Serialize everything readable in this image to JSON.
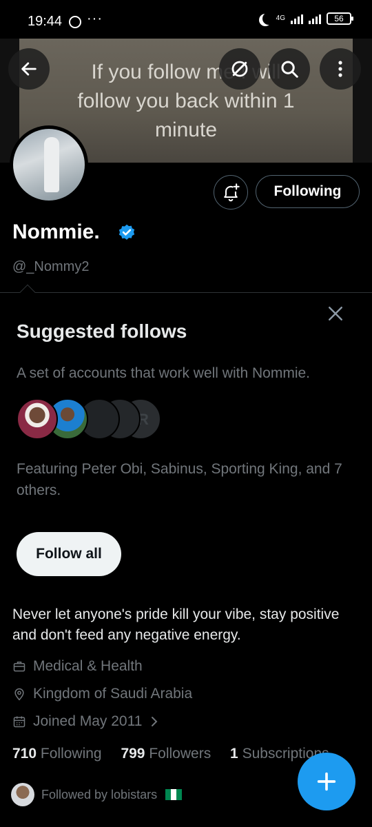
{
  "status_bar": {
    "time": "19:44",
    "network": "4G",
    "battery": "56"
  },
  "banner": {
    "line1": "If you follow me I will",
    "line2": "follow you back within 1",
    "line3": "minute"
  },
  "header": {
    "back_icon": "arrow-left-icon",
    "grok_icon": "grok-icon",
    "search_icon": "search-icon",
    "more_icon": "more-vertical-icon"
  },
  "profile": {
    "name": "Nommie.",
    "handle": "@_Nommy2",
    "following_button": "Following",
    "bio": "Never let anyone's pride kill your vibe, stay positive and don't feed any negative energy.",
    "category": "Medical & Health",
    "location": "Kingdom of Saudi Arabia",
    "joined": "Joined May 2011",
    "stats": {
      "following_count": "710",
      "following_label": "Following",
      "followers_count": "799",
      "followers_label": "Followers",
      "subscriptions_count": "1",
      "subscriptions_label": "Subscriptions"
    },
    "followed_by": "Followed by lobistars"
  },
  "suggested": {
    "title": "Suggested follows",
    "description": "A set of accounts that work well with Nommie.",
    "featuring": "Featuring Peter Obi, Sabinus, Sporting King, and 7 others.",
    "follow_all": "Follow all"
  },
  "colors": {
    "accent": "#1d9bf0",
    "background": "#000000",
    "muted": "#71767b",
    "text": "#e7e9ea"
  }
}
